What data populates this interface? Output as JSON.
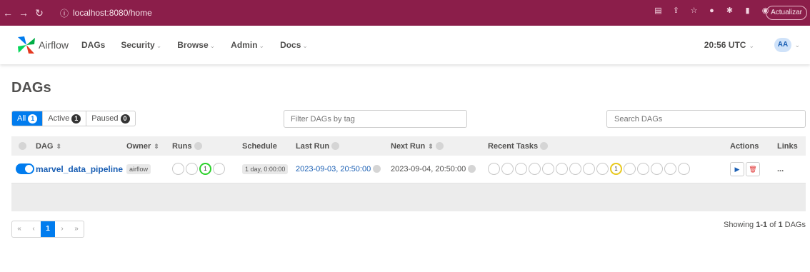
{
  "browser": {
    "url": "localhost:8080/home",
    "update_label": "Actualizar"
  },
  "appbar": {
    "logo_text": "Airflow",
    "menu": [
      {
        "label": "DAGs"
      },
      {
        "label": "Security"
      },
      {
        "label": "Browse"
      },
      {
        "label": "Admin"
      },
      {
        "label": "Docs"
      }
    ],
    "clock": "20:56 UTC",
    "user_initials": "AA"
  },
  "page": {
    "title": "DAGs",
    "filters": [
      {
        "label": "All",
        "count": "1"
      },
      {
        "label": "Active",
        "count": "1"
      },
      {
        "label": "Paused",
        "count": "0"
      }
    ],
    "tag_filter_placeholder": "Filter DAGs by tag",
    "search_placeholder": "Search DAGs"
  },
  "table": {
    "headers": {
      "dag": "DAG",
      "owner": "Owner",
      "runs": "Runs",
      "schedule": "Schedule",
      "last_run": "Last Run",
      "next_run": "Next Run",
      "recent_tasks": "Recent Tasks",
      "actions": "Actions",
      "links": "Links"
    },
    "rows": [
      {
        "dag_id": "marvel_data_pipeline",
        "owner": "airflow",
        "runs_count": "1",
        "schedule": "1 day, 0:00:00",
        "last_run": "2023-09-03, 20:50:00",
        "next_run": "2023-09-04, 20:50:00",
        "recent_tasks_count": "1",
        "links": "..."
      }
    ]
  },
  "pagination": {
    "first": "«",
    "prev": "‹",
    "current": "1",
    "next": "›",
    "last": "»"
  },
  "footer": {
    "showing_prefix": "Showing",
    "range": "1-1",
    "of": "of",
    "total": "1",
    "suffix": "DAGs"
  },
  "colors": {
    "brand_blue": "#017cee",
    "browser_bar": "#8b1e4a",
    "success_green": "#2ad12a",
    "running_yellow": "#e8c81b"
  }
}
